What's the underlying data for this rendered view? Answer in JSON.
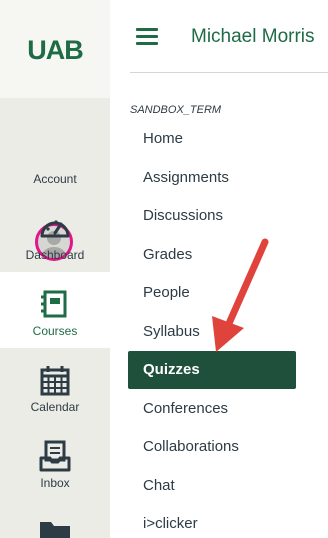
{
  "global_nav": {
    "logo_text": "UAB",
    "items": [
      {
        "label": "Account",
        "icon": "avatar",
        "active": false
      },
      {
        "label": "Dashboard",
        "icon": "dashboard-icon",
        "active": false
      },
      {
        "label": "Courses",
        "icon": "courses-icon",
        "active": true
      },
      {
        "label": "Calendar",
        "icon": "calendar-icon",
        "active": false
      },
      {
        "label": "Inbox",
        "icon": "inbox-icon",
        "active": false
      }
    ]
  },
  "header": {
    "breadcrumb_user": "Michael Morris"
  },
  "course_nav": {
    "term": "SANDBOX_TERM",
    "links": [
      {
        "label": "Home",
        "active": false
      },
      {
        "label": "Assignments",
        "active": false
      },
      {
        "label": "Discussions",
        "active": false
      },
      {
        "label": "Grades",
        "active": false
      },
      {
        "label": "People",
        "active": false
      },
      {
        "label": "Syllabus",
        "active": false
      },
      {
        "label": "Quizzes",
        "active": true
      },
      {
        "label": "Conferences",
        "active": false
      },
      {
        "label": "Collaborations",
        "active": false
      },
      {
        "label": "Chat",
        "active": false
      },
      {
        "label": "i>clicker",
        "active": false
      }
    ]
  },
  "colors": {
    "brand_green": "#1e6b45",
    "active_bg": "#1e503b",
    "nav_bg": "#ecece7",
    "avatar_ring": "#e0168b",
    "arrow_red": "#e0433c"
  }
}
